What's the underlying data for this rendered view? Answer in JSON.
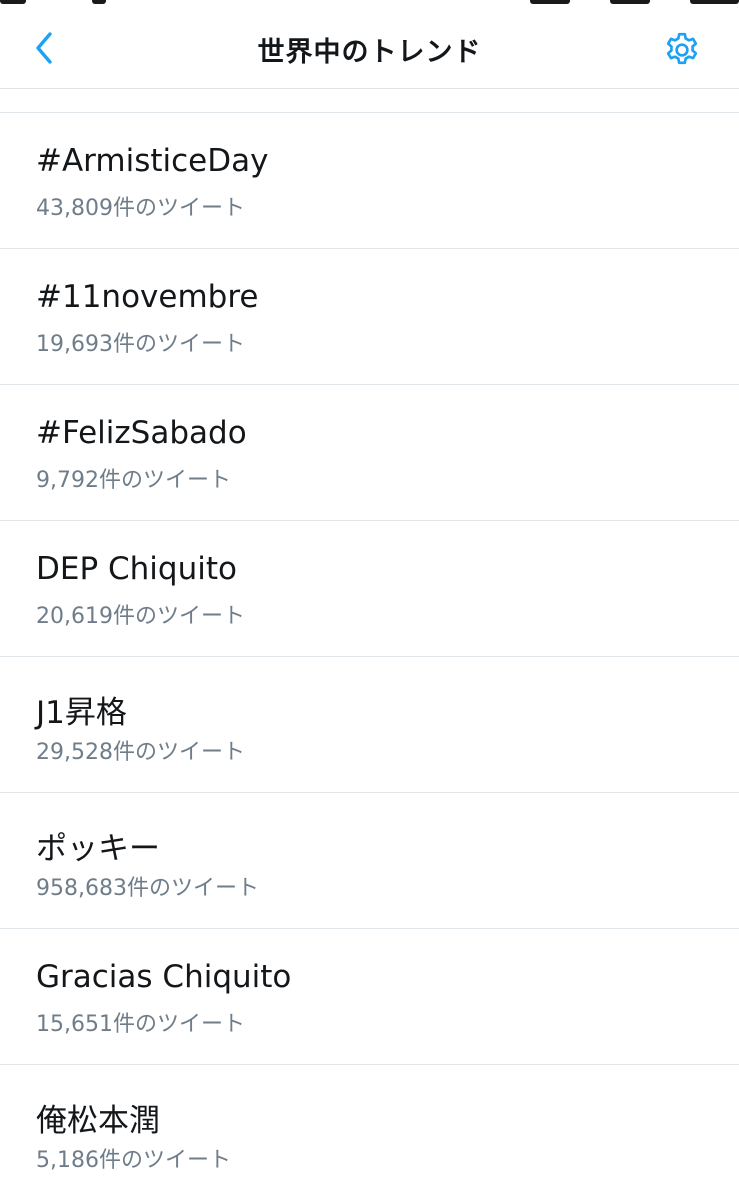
{
  "header": {
    "title": "世界中のトレンド",
    "back_icon": "chevron-left-icon",
    "settings_icon": "gear-icon",
    "accent_color": "#1da1f2"
  },
  "trends": [
    {
      "name": "#ArmisticeDay",
      "count": "43,809件のツイート"
    },
    {
      "name": "#11novembre",
      "count": "19,693件のツイート"
    },
    {
      "name": "#FelizSabado",
      "count": "9,792件のツイート"
    },
    {
      "name": "DEP Chiquito",
      "count": "20,619件のツイート"
    },
    {
      "name": "J1昇格",
      "count": "29,528件のツイート"
    },
    {
      "name": "ポッキー",
      "count": "958,683件のツイート"
    },
    {
      "name": "Gracias Chiquito",
      "count": "15,651件のツイート"
    },
    {
      "name": "俺松本潤",
      "count": "5,186件のツイート"
    }
  ]
}
